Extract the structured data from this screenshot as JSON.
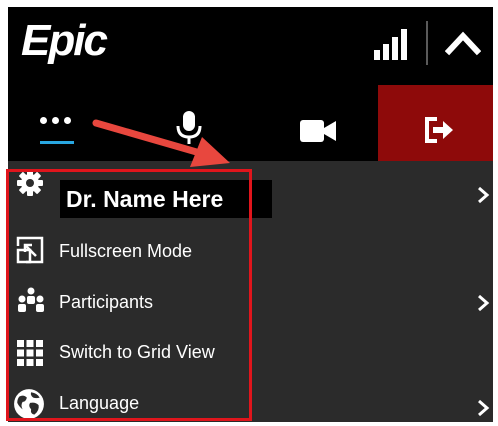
{
  "header": {
    "logo_text": "Epic"
  },
  "icons": {
    "signal": "signal-strength-icon",
    "collapse": "chevron-up-icon",
    "more": "more-dots-icon",
    "mic": "microphone-icon",
    "camera": "video-camera-icon",
    "leave": "leave-exit-icon",
    "settings": "gear-icon",
    "fullscreen": "fullscreen-icon",
    "participants": "participants-icon",
    "grid": "grid-view-icon",
    "language": "globe-icon",
    "submenu": "chevron-right-icon"
  },
  "menu": {
    "items": [
      {
        "label": "",
        "has_submenu": true
      },
      {
        "label": "Fullscreen Mode",
        "has_submenu": false
      },
      {
        "label": "Participants",
        "has_submenu": true
      },
      {
        "label": "Switch to Grid View",
        "has_submenu": false
      },
      {
        "label": "Language",
        "has_submenu": true
      }
    ]
  },
  "overlay": {
    "name_tag": "Dr. Name Here"
  },
  "colors": {
    "background": "#000000",
    "menu_bg": "#2b2b2b",
    "accent_underline": "#29a7e1",
    "leave_bg": "#8e0a0a",
    "highlight": "#e0151c",
    "arrow": "#e8473e"
  }
}
